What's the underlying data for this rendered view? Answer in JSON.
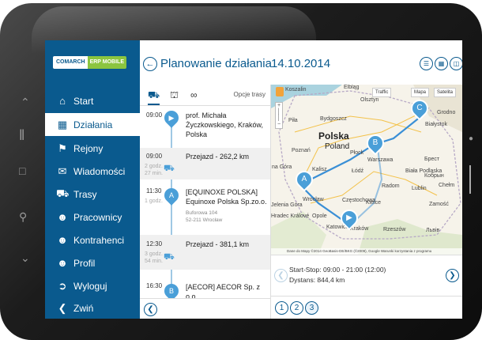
{
  "sidebar": {
    "logo": {
      "brand": "COMARCH",
      "product": "ERP MOBILE"
    },
    "items": [
      {
        "label": "Start"
      },
      {
        "label": "Działania"
      },
      {
        "label": "Rejony"
      },
      {
        "label": "Wiadomości"
      },
      {
        "label": "Trasy"
      },
      {
        "label": "Pracownicy"
      },
      {
        "label": "Kontrahenci"
      },
      {
        "label": "Profil"
      },
      {
        "label": "Wyloguj"
      },
      {
        "label": "Zwiń"
      }
    ],
    "active_index": 1
  },
  "header": {
    "title": "Planowanie działania",
    "date": "14.10.2014"
  },
  "route_options": {
    "label": "Opcje trasy"
  },
  "route": {
    "stop1": {
      "time": "09:00",
      "name": "prof. Michała Życzkowskiego, Kraków, Polska"
    },
    "transit1": {
      "time": "09:00",
      "label": "Przejazd - 262,2 km",
      "duration1": "2 godz.",
      "duration2": "27 min."
    },
    "stop2": {
      "time": "11:30",
      "marker": "A",
      "duration": "1 godz.",
      "name1": "[EQUINOXE POLSKA]",
      "name2": "Equinoxe Polska Sp.zo.o.",
      "addr1": "Buforowa 104",
      "addr2": "52-211 Wrocław"
    },
    "transit2": {
      "time": "12:30",
      "label": "Przejazd - 381,1 km",
      "duration1": "3 godz.",
      "duration2": "54 min."
    },
    "stop3": {
      "time": "16:30",
      "marker": "B",
      "name": "[AECOR] AECOR Sp. z o.o."
    }
  },
  "map": {
    "btn_traffic": "Traffic",
    "btn_map": "Mapa",
    "btn_sat": "Satelita",
    "labels": {
      "koszalin": "Koszalin",
      "elblag": "Elbląg",
      "olsztyn": "Olsztyn",
      "bialystok": "Białystok",
      "polska": "Polska",
      "poland": "Poland",
      "poznan": "Poznań",
      "warszawa": "Warszawa",
      "lodz": "Łódź",
      "kalisz": "Kalisz",
      "radom": "Radom",
      "lublin": "Lublin",
      "wroclaw": "Wrocław",
      "czestochowa": "Częstochowa",
      "katowice": "Katowice",
      "krakow": "Kraków",
      "rzeszow": "Rzeszów",
      "kielce": "Kielce",
      "zamosc": "Zamość",
      "chelm": "Chełm",
      "opole": "Opole",
      "lviv": "Львів",
      "brest": "Брест",
      "kobryn": "Кобрын",
      "pila": "Piła",
      "gorzow": "na Góra",
      "bydgoszcz": "Bydgoszcz",
      "jelenia": "Jelenia Góra",
      "hradec": "Hradec Králové",
      "biala": "Biała Podlaska",
      "plonsk": "Płock",
      "grodno": "Grodno"
    },
    "markers": {
      "a": "A",
      "b": "B",
      "c": "C"
    },
    "copyright": "Dane do Mapy ©2014 GeoBasis-DE/BKG (©2009), Google  Warunki korzystania z programu"
  },
  "summary": {
    "start_stop": "Start-Stop: 09:00 - 21:00 (12:00)",
    "distance": "Dystans: 844,4 km"
  },
  "pages": [
    "1",
    "2",
    "3"
  ]
}
